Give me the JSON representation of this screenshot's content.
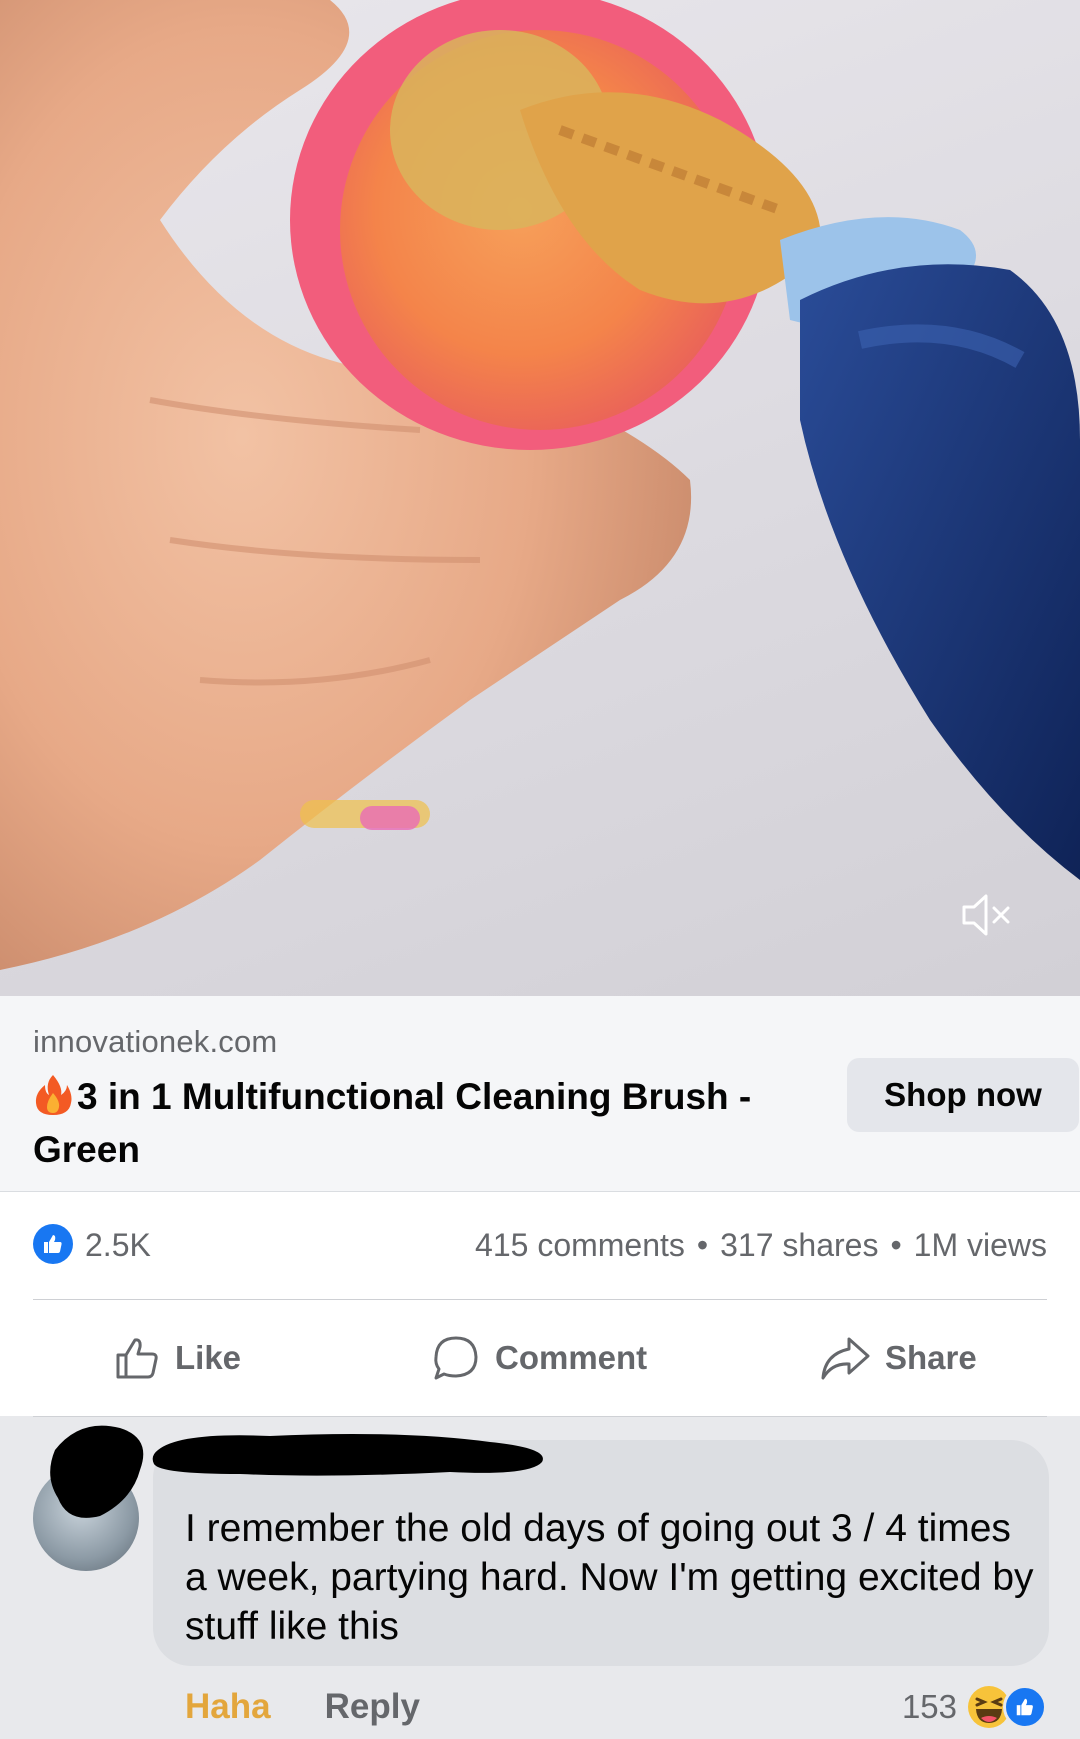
{
  "video": {
    "muted": true,
    "icons": {
      "mute": "speaker-muted-icon"
    }
  },
  "link": {
    "domain": "innovationek.com",
    "title": "3 in 1 Multifunctional Cleaning Brush - Green",
    "title_prefix_icon": "fire-emoji-icon",
    "cta_label": "Shop now"
  },
  "stats": {
    "reaction_count": "2.5K",
    "comments": "415 comments",
    "shares": "317 shares",
    "views": "1M views",
    "separator": "•"
  },
  "actions": {
    "like": "Like",
    "comment": "Comment",
    "share": "Share"
  },
  "comment": {
    "author_redacted": true,
    "text": "I remember the old days of going out 3 / 4 times a week, partying hard. Now I'm getting excited by stuff like this",
    "haha_label": "Haha",
    "reply_label": "Reply",
    "reaction_count": "153",
    "reaction_icons": [
      "haha-emoji-icon",
      "like-reaction-icon"
    ]
  },
  "colors": {
    "facebook_blue": "#1877f2",
    "secondary_text": "#65676b",
    "haha_yellow": "#e3a63c",
    "button_gray": "#e4e6eb",
    "card_bg": "#f5f6f8",
    "comment_bg": "#e8e9ec"
  }
}
